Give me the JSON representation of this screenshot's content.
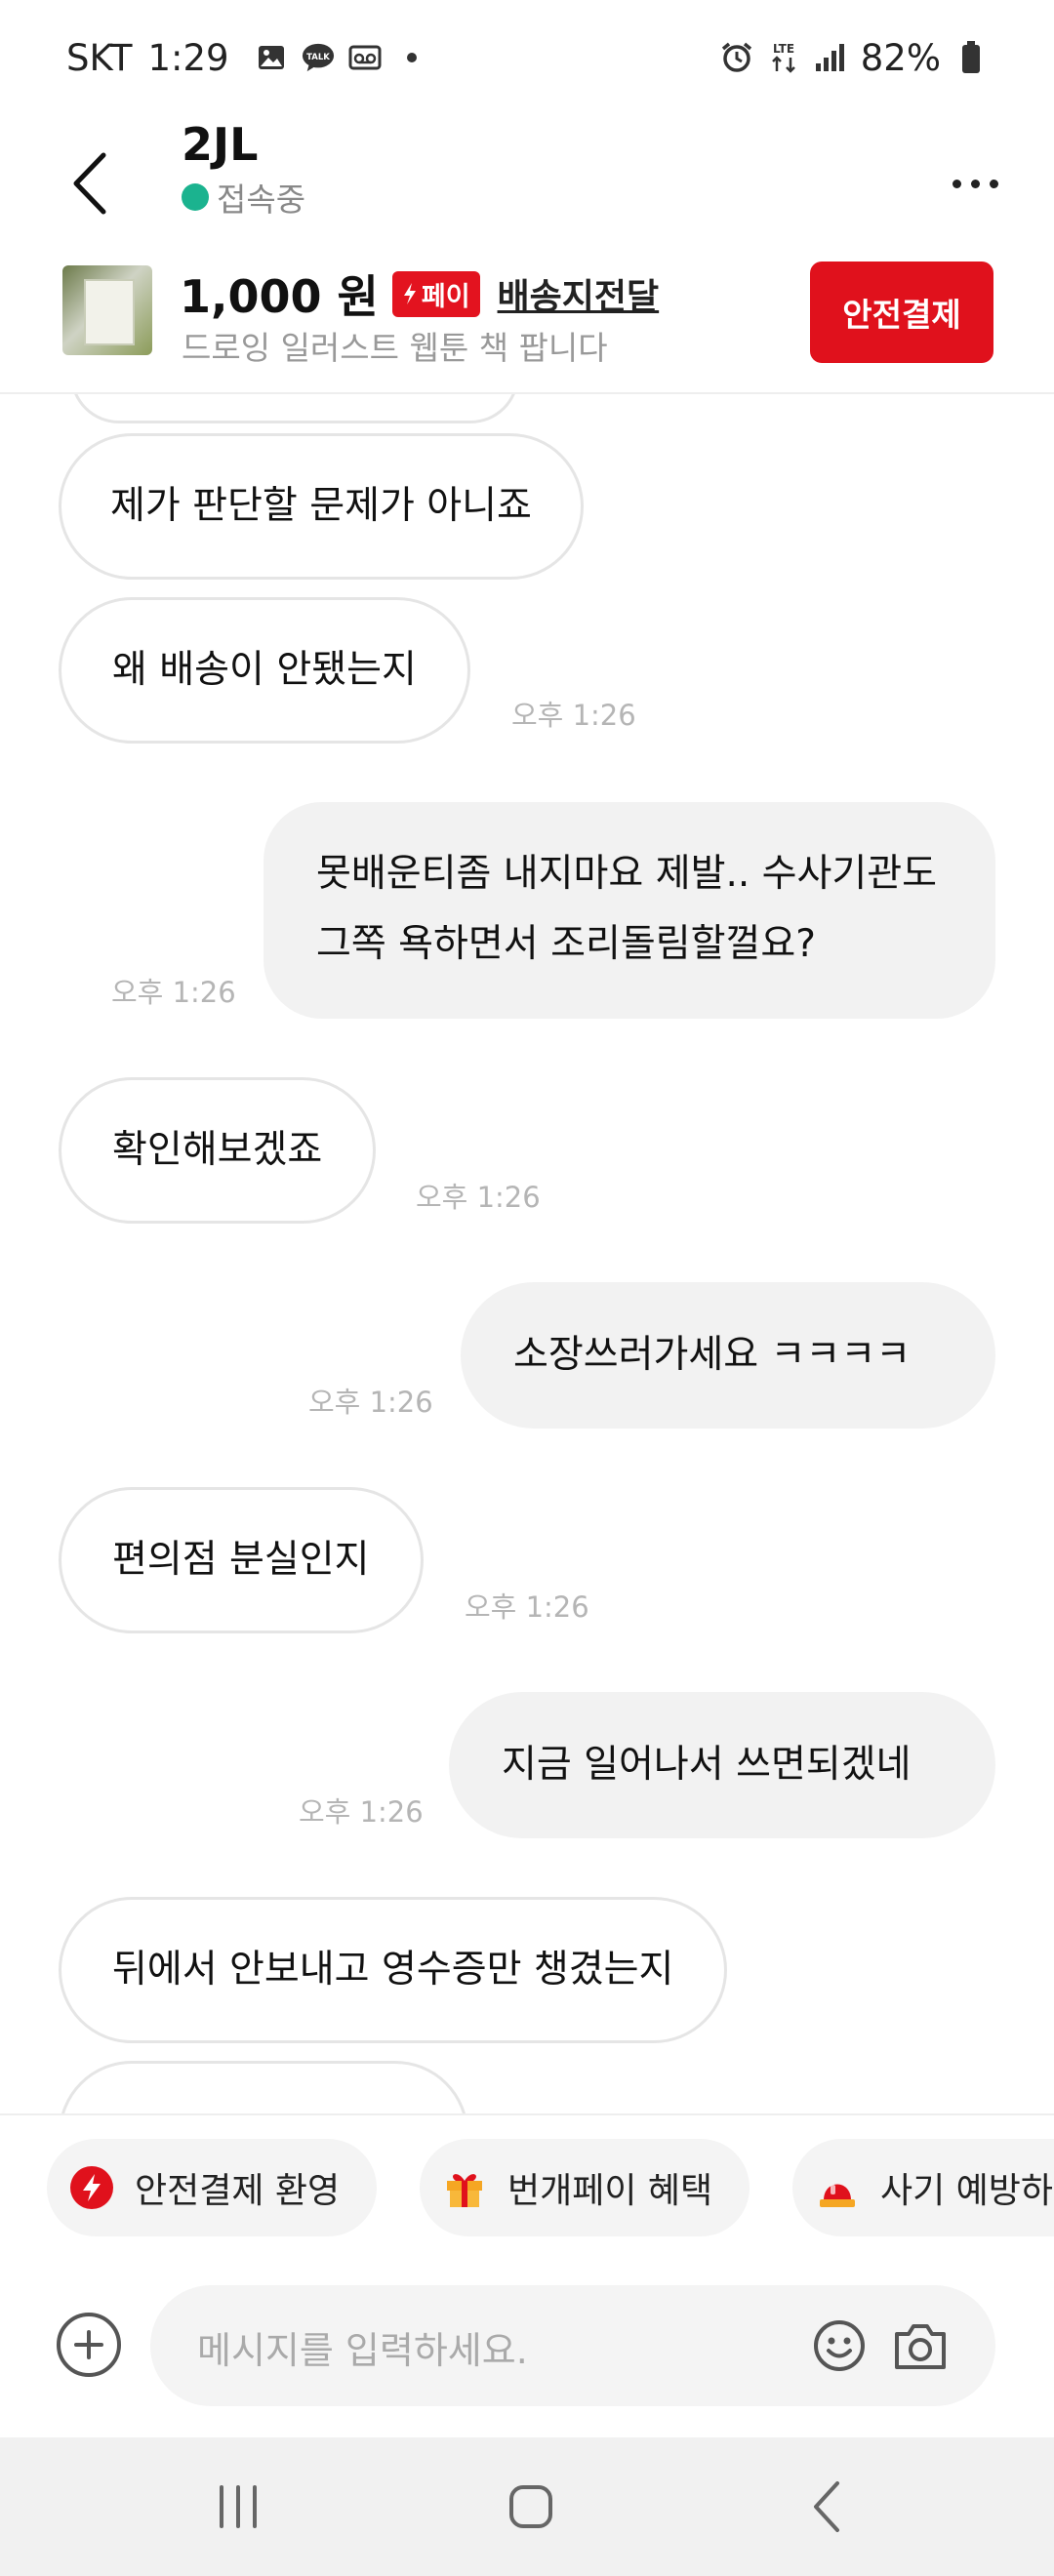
{
  "status_bar": {
    "carrier": "SKT",
    "time": "1:29",
    "notification_icons": [
      "image-icon",
      "talk-icon",
      "voicemail-icon",
      "dot-icon"
    ],
    "network": "LTE",
    "battery": "82%"
  },
  "header": {
    "user_name": "2JL",
    "status": "접속중",
    "status_color": "#1bb38f"
  },
  "product": {
    "price": "1,000",
    "currency": "원",
    "pay_badge": "페이",
    "shipping_label": "배송지전달",
    "title": "드로잉 일러스트 웹툰 책 팝니다",
    "safe_pay_button": "안전결제",
    "accent_color": "#e0111c"
  },
  "messages": [
    {
      "side": "in",
      "text": "제가 판단할 문제가 아니죠",
      "time": ""
    },
    {
      "side": "in",
      "text": "왜 배송이 안됐는지",
      "time": "오후 1:26"
    },
    {
      "side": "out",
      "text": "못배운티좀 내지마요 제발.. 수사기관도 그쪽 욕하면서 조리돌림할껄요?",
      "time": "오후 1:26"
    },
    {
      "side": "in",
      "text": "확인해보겠죠",
      "time": "오후 1:26"
    },
    {
      "side": "out",
      "text": "소장쓰러가세요 ㅋㅋㅋㅋ",
      "time": "오후 1:26"
    },
    {
      "side": "in",
      "text": "편의점 분실인지",
      "time": "오후 1:26"
    },
    {
      "side": "out",
      "text": "지금 일어나서 쓰면되겠네",
      "time": "오후 1:26"
    },
    {
      "side": "in",
      "text": "뒤에서 안보내고 영수증만 챙겼는지",
      "time": ""
    }
  ],
  "quick_replies": [
    {
      "label": "안전결제 환영",
      "icon": "lightning-icon"
    },
    {
      "label": "번개페이 혜택",
      "icon": "gift-icon"
    },
    {
      "label": "사기 예방하",
      "icon": "siren-icon"
    }
  ],
  "input": {
    "placeholder": "메시지를 입력하세요."
  },
  "nav": {
    "buttons": [
      "recent-apps",
      "home",
      "back"
    ]
  }
}
